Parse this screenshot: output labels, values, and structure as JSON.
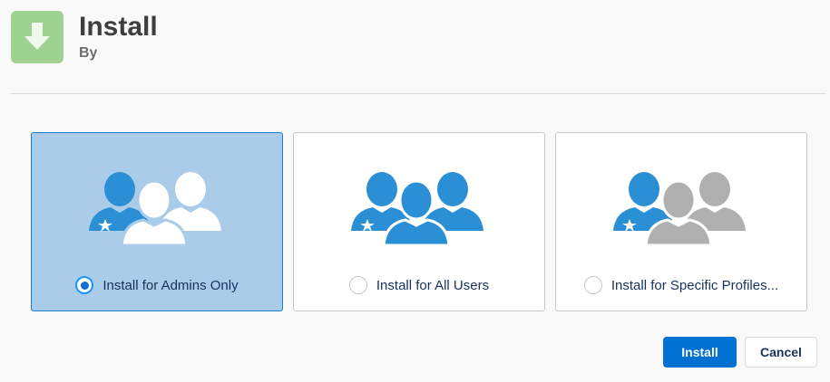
{
  "header": {
    "title": "Install",
    "subtitle": "By"
  },
  "options": [
    {
      "label": "Install for Admins Only",
      "selected": true
    },
    {
      "label": "Install for All Users",
      "selected": false
    },
    {
      "label": "Install for Specific Profiles...",
      "selected": false
    }
  ],
  "buttons": {
    "install_label": "Install",
    "cancel_label": "Cancel"
  },
  "icons": {
    "app": "download-arrow-icon",
    "admins": "admin-users-icon",
    "all_users": "all-users-icon",
    "profiles": "specific-profiles-icon"
  },
  "colors": {
    "accent": "#0070d2",
    "selected_bg": "#aacce8",
    "figure_blue": "#2b8fd6",
    "figure_gray": "#b0b0b0",
    "app_icon_bg": "#9ed290"
  }
}
